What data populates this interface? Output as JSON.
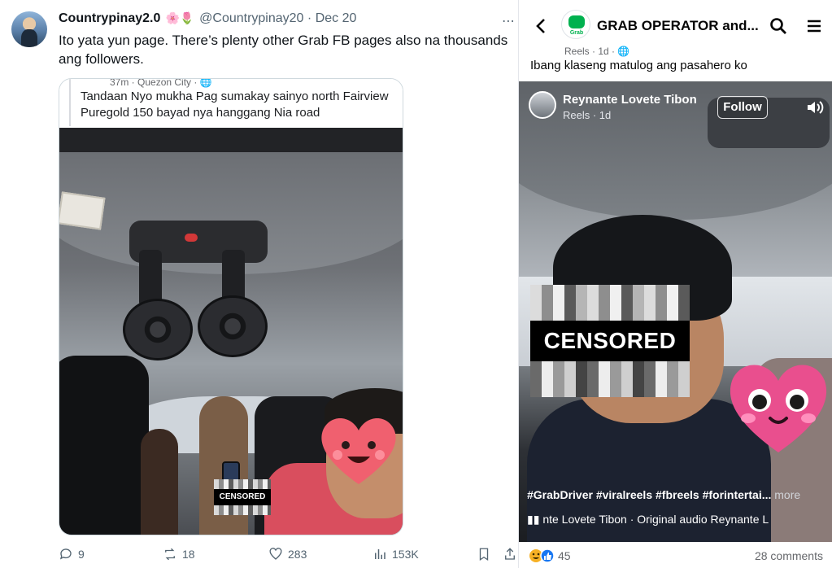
{
  "tweet": {
    "display_name": "Countrypinay2.0",
    "name_emoji": "🌸🌷",
    "handle": "@Countrypinay20",
    "separator": "·",
    "date": "Dec 20",
    "more_icon": "ellipsis-icon",
    "text": "Ito yata yun page. There’s plenty other Grab FB pages also na thousands ang followers.",
    "embedded_post": {
      "meta": "37m · Quezon City · 🌐",
      "caption": "Tandaan Nyo mukha Pag sumakay sainyo north Fairview Puregold 150 bayad nya hanggang Nia road",
      "censor_label": "CENSORED"
    },
    "actions": {
      "replies": "9",
      "reposts": "18",
      "likes": "283",
      "views": "153K"
    }
  },
  "facebook": {
    "group_name": "GRAB OPERATOR and...",
    "logo_text": "Grab",
    "sub_meta": "Reels · 1d · 🌐",
    "post_text": "Ibang klaseng matulog ang pasahero ko",
    "reel": {
      "author": "Reynante Lovete Tibon",
      "author_sub": "Reels · 1d",
      "follow_label": "Follow",
      "censor_label": "CENSORED",
      "hashtags": "#GrabDriver #viralreels #fbreels #forintertai...",
      "more_label": "more",
      "audio": "nte Lovete Tibon · Original audio    Reynante L"
    },
    "footer": {
      "reaction_count": "45",
      "comments": "28 comments"
    }
  }
}
